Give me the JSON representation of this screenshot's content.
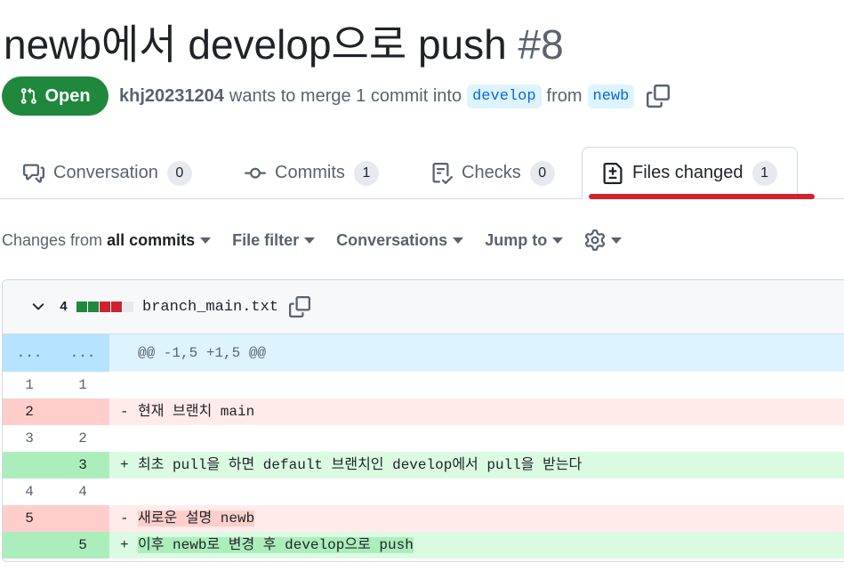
{
  "pr": {
    "title": "newb에서 develop으로 push",
    "number": "#8",
    "state": "Open",
    "author": "khj20231204",
    "merge_text": "wants to merge 1 commit into",
    "base_branch": "develop",
    "from_text": "from",
    "head_branch": "newb"
  },
  "tabs": [
    {
      "label": "Conversation",
      "count": "0",
      "icon": "conversation-icon"
    },
    {
      "label": "Commits",
      "count": "1",
      "icon": "commit-icon"
    },
    {
      "label": "Checks",
      "count": "0",
      "icon": "checklist-icon"
    },
    {
      "label": "Files changed",
      "count": "1",
      "icon": "file-diff-icon",
      "active": true
    }
  ],
  "toolbar": {
    "changes_prefix": "Changes from",
    "changes_value": "all commits",
    "file_filter": "File filter",
    "conversations": "Conversations",
    "jump_to": "Jump to"
  },
  "file": {
    "changes": "4",
    "name": "branch_main.txt",
    "diffstat_colors": [
      "#1f883d",
      "#1f883d",
      "#cf222e",
      "#cf222e",
      "#e6eaef"
    ],
    "hunk": {
      "left": "...",
      "right": "...",
      "header": "@@ -1,5 +1,5 @@"
    },
    "lines": [
      {
        "type": "ctx",
        "old": "1",
        "new": "1",
        "sign": "",
        "text": ""
      },
      {
        "type": "del",
        "old": "2",
        "new": "",
        "sign": "-",
        "text": "현재 브랜치 main"
      },
      {
        "type": "ctx",
        "old": "3",
        "new": "2",
        "sign": "",
        "text": ""
      },
      {
        "type": "add",
        "old": "",
        "new": "3",
        "sign": "+",
        "text": "최초 pull을 하면 default 브랜치인 develop에서 pull을 받는다"
      },
      {
        "type": "ctx",
        "old": "4",
        "new": "4",
        "sign": "",
        "text": ""
      },
      {
        "type": "del",
        "old": "5",
        "new": "",
        "sign": "-",
        "text": "새로운 설명 newb",
        "highlight": true
      },
      {
        "type": "add",
        "old": "",
        "new": "5",
        "sign": "+",
        "text": "이후 newb로 변경 후 develop으로 push",
        "highlight": true
      }
    ]
  },
  "colors": {
    "open_green": "#1f883d",
    "annotation_red": "#d1242f",
    "branch_blue": "#0969da"
  }
}
